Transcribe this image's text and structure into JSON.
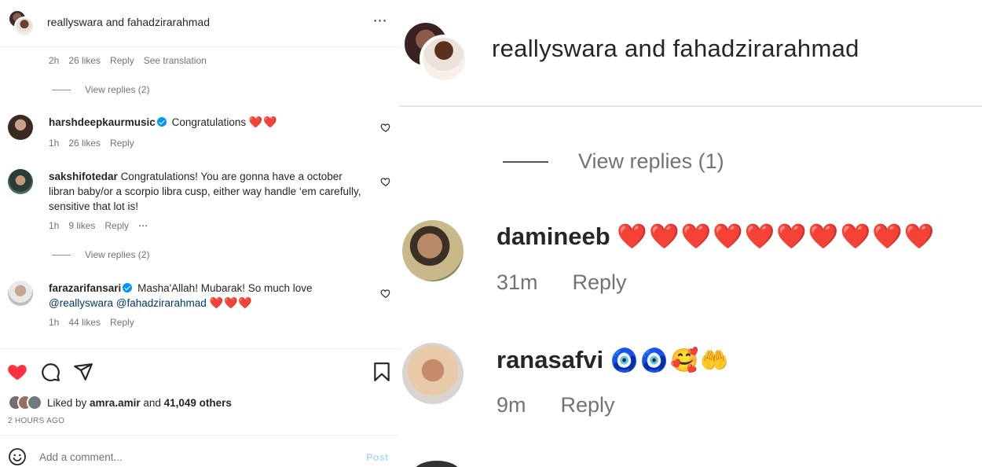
{
  "left": {
    "header": {
      "title": "reallyswara and fahadzirarahmad",
      "more_icon": "⋯"
    },
    "first_meta": {
      "time": "2h",
      "likes": "26 likes",
      "reply": "Reply",
      "translate": "See translation"
    },
    "view_replies_1": "View replies (2)",
    "comments": [
      {
        "username": "harshdeepkaurmusic",
        "verified": true,
        "text": "Congratulations",
        "hearts": "❤️❤️",
        "time": "1h",
        "likes": "26 likes",
        "reply": "Reply"
      },
      {
        "username": "sakshifotedar",
        "verified": false,
        "text": "Congratulations! You are gonna have a october libran baby/or a scorpio libra cusp, either way handle ‘em carefully, sensitive that lot is!",
        "time": "1h",
        "likes": "9 likes",
        "reply": "Reply",
        "more": "⋯"
      },
      {
        "username": "farazarifansari",
        "verified": true,
        "text": "Masha'Allah! Mubarak! So much love",
        "mention1": "@reallyswara",
        "mention2": "@fahadzirarahmad",
        "hearts": "❤️❤️❤️",
        "time": "1h",
        "likes": "44 likes",
        "reply": "Reply"
      }
    ],
    "view_replies_2": "View replies (2)",
    "liked_by": {
      "prefix": "Liked by ",
      "user": "amra.amir",
      "mid": " and ",
      "others": "41,049 others"
    },
    "timestamp": "2 HOURS AGO",
    "add_comment": {
      "placeholder": "Add a comment...",
      "post": "Post"
    },
    "colors": {
      "like_red": "#ff3040",
      "link_blue": "#00376b",
      "verified_blue": "#0095f6",
      "post_disabled": "#b3dbff"
    }
  },
  "right": {
    "header_title": "reallyswara and fahadzirarahmad",
    "view_replies": "View replies (1)",
    "comments": [
      {
        "username": "damineeb",
        "emojis": "❤️❤️❤️❤️❤️❤️❤️❤️❤️❤️",
        "time": "31m",
        "reply": "Reply"
      },
      {
        "username": "ranasafvi",
        "emojis": "🧿🧿🥰🤲",
        "time": "9m",
        "reply": "Reply"
      }
    ]
  }
}
